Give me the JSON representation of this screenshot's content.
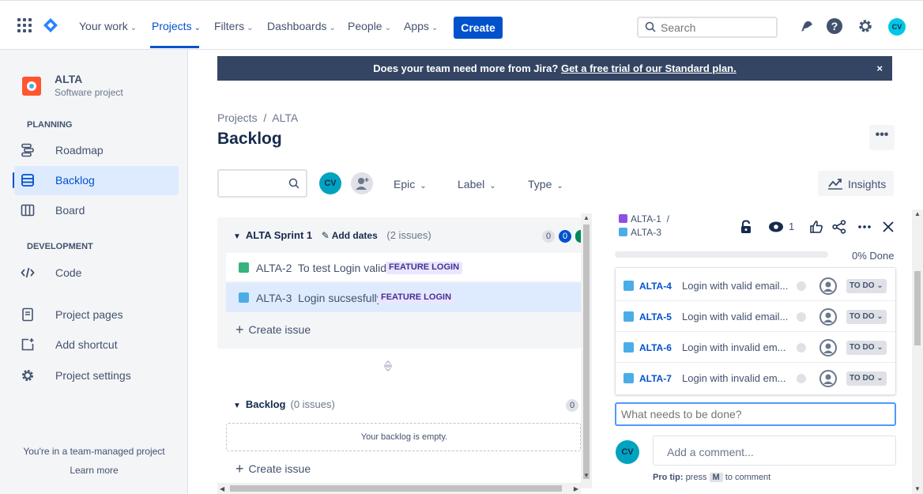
{
  "topnav": {
    "items": [
      {
        "label": "Your work"
      },
      {
        "label": "Projects"
      },
      {
        "label": "Filters"
      },
      {
        "label": "Dashboards"
      },
      {
        "label": "People"
      },
      {
        "label": "Apps"
      }
    ],
    "create_label": "Create",
    "search_placeholder": "Search",
    "user_initials": "CV"
  },
  "sidebar": {
    "project_name": "ALTA",
    "project_type": "Software project",
    "planning_heading": "PLANNING",
    "development_heading": "DEVELOPMENT",
    "items": [
      {
        "label": "Roadmap"
      },
      {
        "label": "Backlog"
      },
      {
        "label": "Board"
      },
      {
        "label": "Code"
      },
      {
        "label": "Project pages"
      },
      {
        "label": "Add shortcut"
      },
      {
        "label": "Project settings"
      }
    ],
    "team_note": "You're in a team-managed project",
    "learn_more": "Learn more"
  },
  "banner": {
    "text": "Does your team need more from Jira?",
    "link": "Get a free trial of our Standard plan.",
    "close": "×"
  },
  "breadcrumb": "Projects  /  ALTA",
  "page_title": "Backlog",
  "more_label": "•••",
  "toolbar": {
    "avatar_initials": "CV",
    "epic_label": "Epic",
    "label_label": "Label",
    "type_label": "Type",
    "insights_label": "Insights"
  },
  "sprint": {
    "name": "ALTA Sprint 1",
    "add_dates": "Add dates",
    "count": "(2 issues)",
    "pill_todo": "0",
    "pill_progress": "0",
    "issues": [
      {
        "key": "ALTA-2",
        "summary": "To test Login valid",
        "epic": "FEATURE LOGIN"
      },
      {
        "key": "ALTA-3",
        "summary": "Login sucsesfully",
        "epic": "FEATURE LOGIN"
      }
    ],
    "create_issue": "Create issue"
  },
  "backlog": {
    "name": "Backlog",
    "count": "(0 issues)",
    "pill": "0",
    "empty_text": "Your backlog is empty.",
    "create_issue": "Create issue"
  },
  "detail": {
    "parent_key": "ALTA-1",
    "parent_sep": "/",
    "issue_key": "ALTA-3",
    "watch_count": "1",
    "progress_label": "0% Done",
    "progress": 0,
    "children": [
      {
        "key": "ALTA-4",
        "summary": "Login with valid email...",
        "status": "TO DO"
      },
      {
        "key": "ALTA-5",
        "summary": "Login with valid email...",
        "status": "TO DO"
      },
      {
        "key": "ALTA-6",
        "summary": "Login with invalid em...",
        "status": "TO DO"
      },
      {
        "key": "ALTA-7",
        "summary": "Login with invalid em...",
        "status": "TO DO"
      }
    ],
    "new_child_placeholder": "What needs to be done?",
    "comment_avatar": "CV",
    "comment_placeholder": "Add a comment...",
    "pro_tip_label": "Pro tip:",
    "pro_tip_press": "press",
    "pro_tip_key": "M",
    "pro_tip_rest": "to comment"
  },
  "colors": {
    "brand": "#0052cc",
    "banner": "#344563",
    "selected": "#deebff",
    "epic_bg": "#eae6ff",
    "story": "#36b37e",
    "task": "#4bade8"
  }
}
